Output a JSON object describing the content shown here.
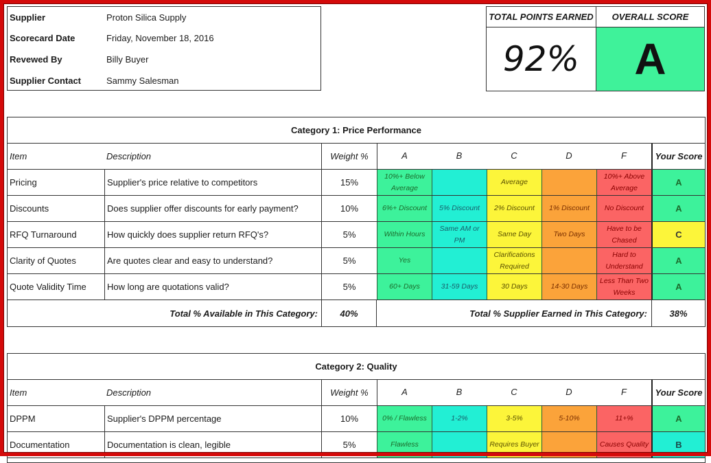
{
  "supplier_info": [
    {
      "label": "Supplier",
      "value": "Proton Silica Supply"
    },
    {
      "label": "Scorecard Date",
      "value": "Friday, November 18, 2016"
    },
    {
      "label": "Revewed By",
      "value": "Billy Buyer"
    },
    {
      "label": "Supplier Contact",
      "value": "Sammy Salesman"
    }
  ],
  "summary": {
    "total_points_label": "TOTAL POINTS EARNED",
    "overall_score_label": "OVERALL SCORE",
    "total_points_value": "92%",
    "overall_score_value": "A",
    "overall_score_color": "#3ff29a"
  },
  "grade_colors": {
    "A": "#3df29b",
    "B": "#22efd4",
    "C": "#fcf53a",
    "D": "#fba33a",
    "F": "#fb6464"
  },
  "columns": {
    "item": "Item",
    "description": "Description",
    "weight": "Weight %",
    "A": "A",
    "B": "B",
    "C": "C",
    "D": "D",
    "F": "F",
    "your_score": "Your Score"
  },
  "categories": [
    {
      "title": "Category 1: Price Performance",
      "rows": [
        {
          "item": "Pricing",
          "description": "Supplier's price relative to competitors",
          "weight": "15%",
          "A": "10%+ Below Average",
          "B": "",
          "C": "Average",
          "D": "",
          "F": "10%+ Above Average",
          "score": "A"
        },
        {
          "item": "Discounts",
          "description": "Does supplier offer discounts for early payment?",
          "weight": "10%",
          "A": "6%+ Discount",
          "B": "5% Discount",
          "C": "2% Discount",
          "D": "1% Discount",
          "F": "No Discount",
          "score": "A"
        },
        {
          "item": "RFQ Turnaround",
          "description": "How quickly does supplier return RFQ's?",
          "weight": "5%",
          "A": "Within Hours",
          "B": "Same AM or PM",
          "C": "Same Day",
          "D": "Two Days",
          "F": "Have to be Chased",
          "score": "C"
        },
        {
          "item": "Clarity of Quotes",
          "description": "Are quotes clear and easy to understand?",
          "weight": "5%",
          "A": "Yes",
          "B": "",
          "C": "Clarifications Required",
          "D": "",
          "F": "Hard to Understand",
          "score": "A"
        },
        {
          "item": "Quote Validity Time",
          "description": "How long are quotations valid?",
          "weight": "5%",
          "A": "60+ Days",
          "B": "31-59 Days",
          "C": "30 Days",
          "D": "14-30 Days",
          "F": "Less Than Two Weeks",
          "score": "A"
        }
      ],
      "total_available_label": "Total % Available in This Category:",
      "total_available_value": "40%",
      "total_earned_label": "Total % Supplier Earned in This Category:",
      "total_earned_value": "38%"
    },
    {
      "title": "Category 2: Quality",
      "rows": [
        {
          "item": "DPPM",
          "description": "Supplier's DPPM percentage",
          "weight": "10%",
          "A": "0% / Flawless",
          "B": "1-2%",
          "C": "3-5%",
          "D": "5-10%",
          "F": "11+%",
          "score": "A"
        },
        {
          "item": "Documentation",
          "description": "Documentation is clean, legible",
          "weight": "5%",
          "A": "Flawless",
          "B": "",
          "C": "Requires Buyer",
          "D": "",
          "F": "Causes Quality",
          "score": "B"
        }
      ]
    }
  ]
}
